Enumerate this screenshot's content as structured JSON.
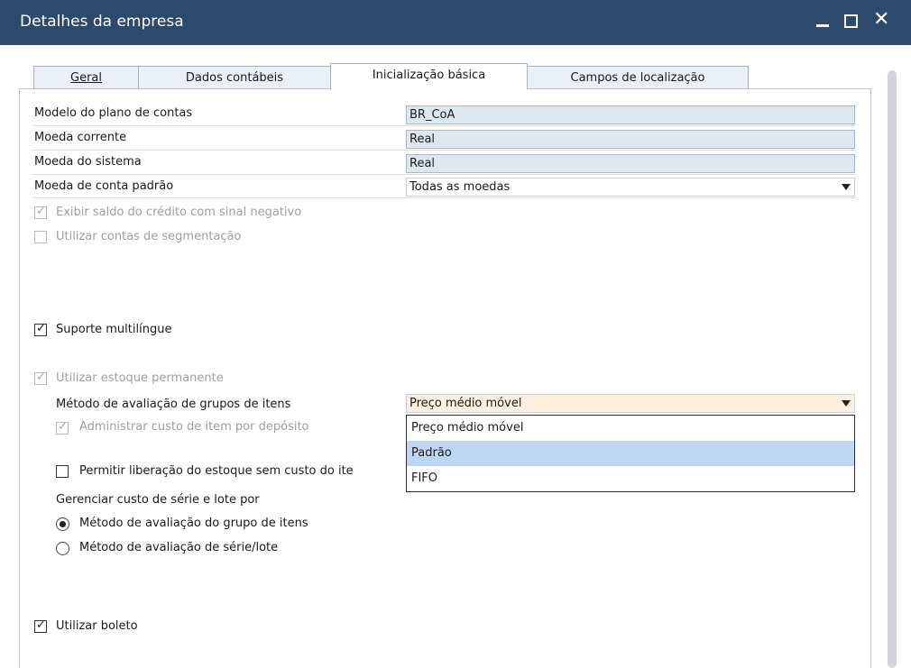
{
  "window": {
    "title": "Detalhes da empresa",
    "min_icon": "minimize-icon",
    "max_icon": "maximize-icon",
    "close_icon": "close-icon"
  },
  "tabs": [
    {
      "label": "Geral"
    },
    {
      "label": "Dados contábeis"
    },
    {
      "label": "Inicialização básica",
      "active": true
    },
    {
      "label": "Campos de localização"
    }
  ],
  "fields": {
    "chart_of_accounts": {
      "label": "Modelo do plano de contas",
      "value": "BR_CoA"
    },
    "local_currency": {
      "label": "Moeda corrente",
      "value": "Real"
    },
    "system_currency": {
      "label": "Moeda do sistema",
      "value": "Real"
    },
    "default_account_currency": {
      "label": "Moeda de conta padrão",
      "value": "Todas as moedas"
    }
  },
  "checkboxes": {
    "negative_credit": {
      "label": "Exibir saldo do crédito com sinal negativo",
      "checked": true,
      "disabled": true
    },
    "segmentation": {
      "label": "Utilizar contas de segmentação",
      "checked": false,
      "disabled": true
    },
    "multilingual": {
      "label": "Suporte multilíngue",
      "checked": true,
      "disabled": false
    },
    "perpetual_inventory": {
      "label": "Utilizar estoque permanente",
      "checked": true,
      "disabled": true
    },
    "manage_cost_per_warehouse": {
      "label": "Administrar custo de item por depósito",
      "checked": true,
      "disabled": true
    },
    "release_without_cost": {
      "label": "Permitir liberação do estoque sem custo do ite",
      "checked": false,
      "disabled": false
    },
    "use_boleto": {
      "label": "Utilizar boleto",
      "checked": true,
      "disabled": false
    }
  },
  "valuation": {
    "label": "Método de avaliação de grupos de itens",
    "value": "Preço médio móvel",
    "options": [
      "Preço médio móvel",
      "Padrão",
      "FIFO"
    ],
    "highlighted": "Padrão"
  },
  "serial_batch": {
    "label": "Gerenciar custo de série e lote por",
    "options": [
      {
        "label": "Método de avaliação do grupo de itens",
        "selected": true
      },
      {
        "label": "Método de avaliação de série/lote",
        "selected": false
      }
    ]
  }
}
